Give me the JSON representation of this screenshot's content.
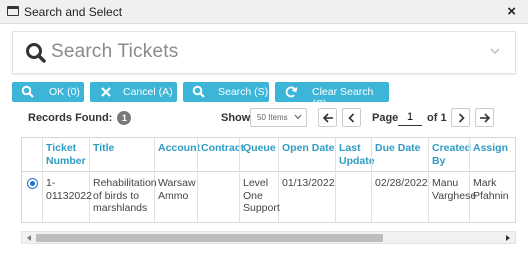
{
  "window": {
    "title": "Search and Select",
    "close_glyph": "×"
  },
  "search": {
    "placeholder": "Search Tickets",
    "icon": "search-icon",
    "caret": "chevron-down-icon"
  },
  "toolbar": {
    "ok_label": "OK (0)",
    "cancel_label": "Cancel (A)",
    "search_label": "Search (S)",
    "clear_label": "Clear Search (C)",
    "accent_color": "#3db5d8"
  },
  "records": {
    "label": "Records Found:",
    "count": "1"
  },
  "pager": {
    "show_label": "Show:",
    "show_value": "50 Items",
    "page_label": "Page",
    "page_value": "1",
    "of_label": "of 1"
  },
  "table": {
    "columns": [
      "Ticket Number",
      "Title",
      "Account",
      "Contract",
      "Queue",
      "Open Date",
      "Last Update",
      "Due Date",
      "Created By",
      "Assigned"
    ],
    "columns_visible": [
      "Ticket\nNumber",
      "Title",
      "Account",
      "Contract",
      "Queue",
      "Open Date",
      "Last\nUpdate",
      "Due Date",
      "Created\nBy",
      "Assign"
    ],
    "rows": [
      {
        "selected": true,
        "ticket_number": "1-\n01132022",
        "title": "Rehabilitation\nof birds to\nmarshlands",
        "account": "Warsaw\nAmmo",
        "contract": "",
        "queue": "Level\nOne\nSupport",
        "open_date": "01/13/2022",
        "last_update": "",
        "due_date": "02/28/2022",
        "created_by": "Manu\nVarghese",
        "assigned": "Mark\nPfahnin"
      }
    ]
  }
}
